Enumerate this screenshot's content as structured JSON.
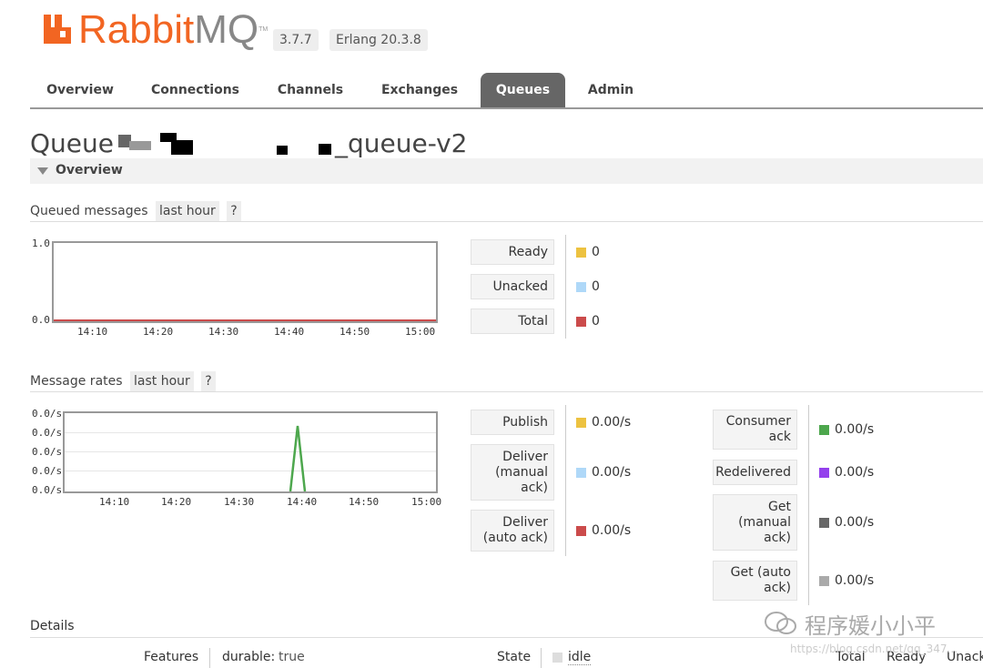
{
  "header": {
    "logo_text_rabbit": "Rabbit",
    "logo_text_mq": "MQ",
    "logo_tm": "TM",
    "version": "3.7.7",
    "erlang": "Erlang 20.3.8"
  },
  "tabs": [
    "Overview",
    "Connections",
    "Channels",
    "Exchanges",
    "Queues",
    "Admin"
  ],
  "active_tab": "Queues",
  "page": {
    "title_prefix": "Queue",
    "title_suffix": "_queue-v2"
  },
  "overview": {
    "section_label": "Overview",
    "queued": {
      "label": "Queued messages",
      "range": "last hour",
      "help": "?",
      "y_ticks": [
        "1.0",
        "0.0"
      ],
      "x_ticks": [
        "14:10",
        "14:20",
        "14:30",
        "14:40",
        "14:50",
        "15:00"
      ],
      "legend": [
        {
          "label": "Ready",
          "value": "0",
          "color": "#edc240"
        },
        {
          "label": "Unacked",
          "value": "0",
          "color": "#afd8f8"
        },
        {
          "label": "Total",
          "value": "0",
          "color": "#cb4b4b"
        }
      ]
    },
    "rates": {
      "label": "Message rates",
      "range": "last hour",
      "help": "?",
      "y_ticks": [
        "0.0/s",
        "0.0/s",
        "0.0/s",
        "0.0/s",
        "0.0/s"
      ],
      "x_ticks": [
        "14:10",
        "14:20",
        "14:30",
        "14:40",
        "14:50",
        "15:00"
      ],
      "legend_left": [
        {
          "label": "Publish",
          "value": "0.00/s",
          "color": "#edc240"
        },
        {
          "label": "Deliver (manual ack)",
          "value": "0.00/s",
          "color": "#afd8f8"
        },
        {
          "label": "Deliver (auto ack)",
          "value": "0.00/s",
          "color": "#cb4b4b"
        }
      ],
      "legend_right": [
        {
          "label": "Consumer ack",
          "value": "0.00/s",
          "color": "#4da74d"
        },
        {
          "label": "Redelivered",
          "value": "0.00/s",
          "color": "#9440ed"
        },
        {
          "label": "Get (manual ack)",
          "value": "0.00/s",
          "color": "#666666"
        },
        {
          "label": "Get (auto ack)",
          "value": "0.00/s",
          "color": "#aaaaaa"
        }
      ]
    }
  },
  "details": {
    "label": "Details",
    "features_label": "Features",
    "durable_key": "durable:",
    "durable_value": "true",
    "state_label": "State",
    "state_value": "idle",
    "cols": [
      "Total",
      "Ready",
      "Unack"
    ]
  },
  "watermark": {
    "text": "程序媛小小平",
    "url": "https://blog.csdn.net/qq_347..."
  }
}
